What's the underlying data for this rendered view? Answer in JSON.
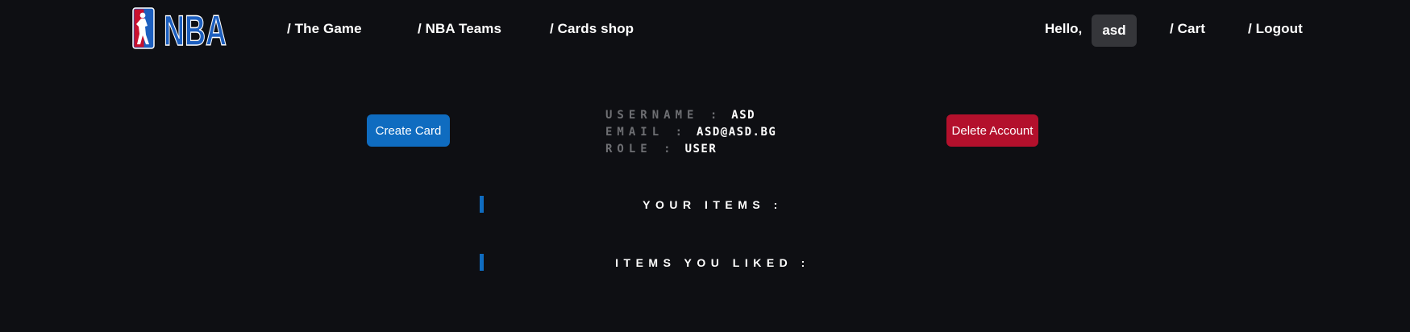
{
  "nav": {
    "logo_text": "NBA",
    "links": {
      "the_game": "/ The Game",
      "nba_teams": "/ NBA Teams",
      "cards_shop": "/ Cards shop",
      "cart": "/ Cart",
      "logout": "/ Logout"
    },
    "greeting": "Hello,",
    "username": "asd"
  },
  "profile": {
    "create_card_label": "Create Card",
    "delete_account_label": "Delete Account",
    "username_label": "USERNAME :",
    "username_value": "ASD",
    "email_label": "EMAIL :",
    "email_value": "ASD@ASD.BG",
    "role_label": "ROLE :",
    "role_value": "USER"
  },
  "sections": {
    "your_items": "YOUR ITEMS :",
    "items_liked": "ITEMS YOU LIKED :"
  },
  "colors": {
    "background": "#0e0f13",
    "accent_blue": "#0f6cc0",
    "danger_red": "#b3102c",
    "muted_label": "#6e6f73",
    "badge_bg": "#35363a",
    "logo_blue": "#1d5fbf",
    "logo_red": "#c8102e"
  }
}
